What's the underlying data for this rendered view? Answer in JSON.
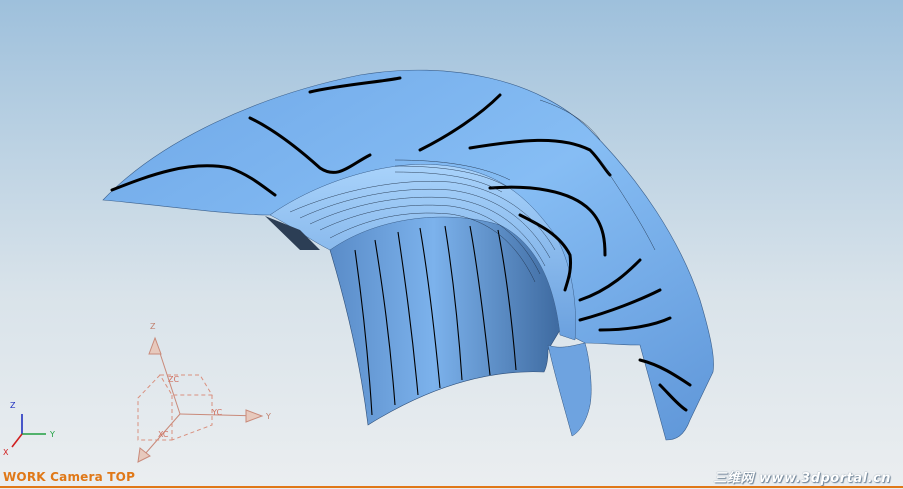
{
  "viewport": {
    "view_label": "WORK Camera TOP",
    "watermark": "三维网 www.3dportal.cn",
    "colors": {
      "background_top": "#9ec0dc",
      "background_bottom": "#ebeef0",
      "surface": "#7fb4ee",
      "contour_lines": "#000000",
      "label_orange": "#e07818"
    }
  },
  "triad": {
    "labels": {
      "z": "Z",
      "y": "Y",
      "x": "X"
    }
  },
  "wcs": {
    "labels": {
      "z": "Z",
      "zc": "ZC",
      "y": "Y",
      "yc": "YC",
      "xc": "XC"
    }
  }
}
